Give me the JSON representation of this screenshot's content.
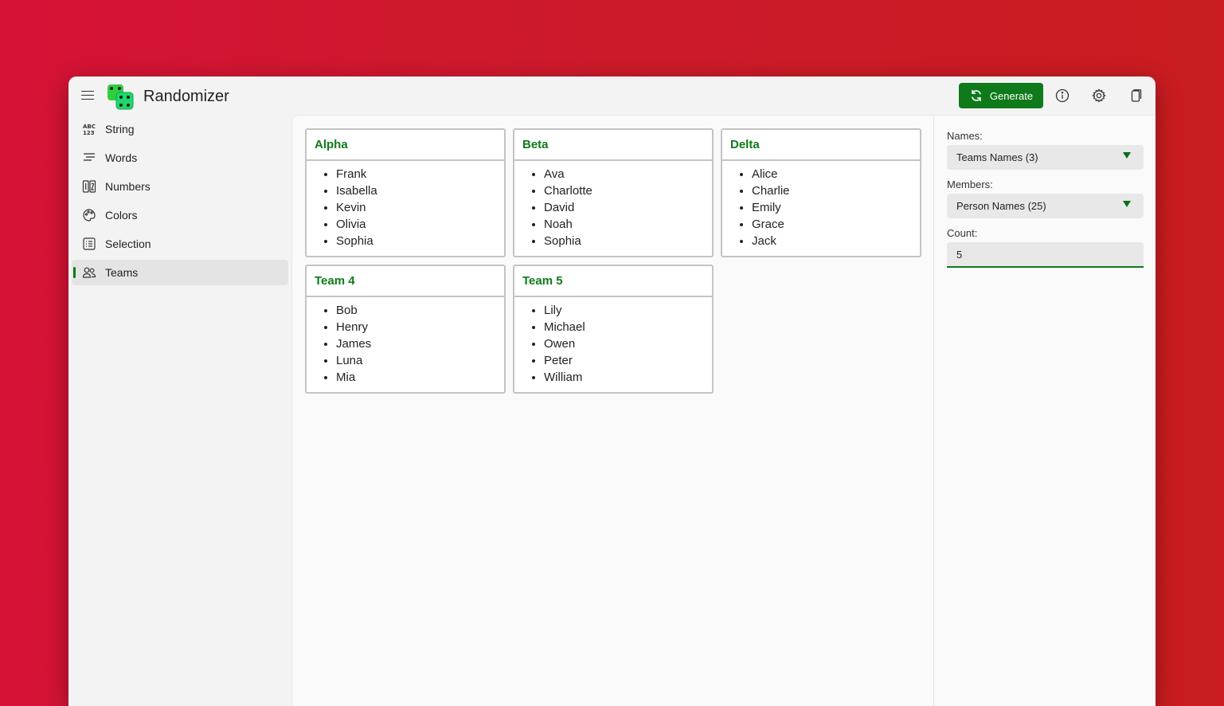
{
  "app": {
    "title": "Randomizer"
  },
  "toolbar": {
    "generate_label": "Generate",
    "accent_color": "#0e7a1a",
    "icons": [
      "refresh-icon",
      "info-icon",
      "gear-icon",
      "copy-icon"
    ]
  },
  "sidebar": {
    "items": [
      {
        "label": "String",
        "icon": "abc-123-icon"
      },
      {
        "label": "Words",
        "icon": "text-lines-icon"
      },
      {
        "label": "Numbers",
        "icon": "numbers-icon"
      },
      {
        "label": "Colors",
        "icon": "palette-icon"
      },
      {
        "label": "Selection",
        "icon": "list-selection-icon"
      },
      {
        "label": "Teams",
        "icon": "people-icon",
        "active": true
      }
    ]
  },
  "teams": [
    {
      "name": "Alpha",
      "members": [
        "Frank",
        "Isabella",
        "Kevin",
        "Olivia",
        "Sophia"
      ]
    },
    {
      "name": "Beta",
      "members": [
        "Ava",
        "Charlotte",
        "David",
        "Noah",
        "Sophia"
      ]
    },
    {
      "name": "Delta",
      "members": [
        "Alice",
        "Charlie",
        "Emily",
        "Grace",
        "Jack"
      ]
    },
    {
      "name": "Team 4",
      "members": [
        "Bob",
        "Henry",
        "James",
        "Luna",
        "Mia"
      ]
    },
    {
      "name": "Team 5",
      "members": [
        "Lily",
        "Michael",
        "Owen",
        "Peter",
        "William"
      ]
    }
  ],
  "settings": {
    "names_label": "Names:",
    "names_value": "Teams Names (3)",
    "members_label": "Members:",
    "members_value": "Person Names (25)",
    "count_label": "Count:",
    "count_value": "5"
  }
}
